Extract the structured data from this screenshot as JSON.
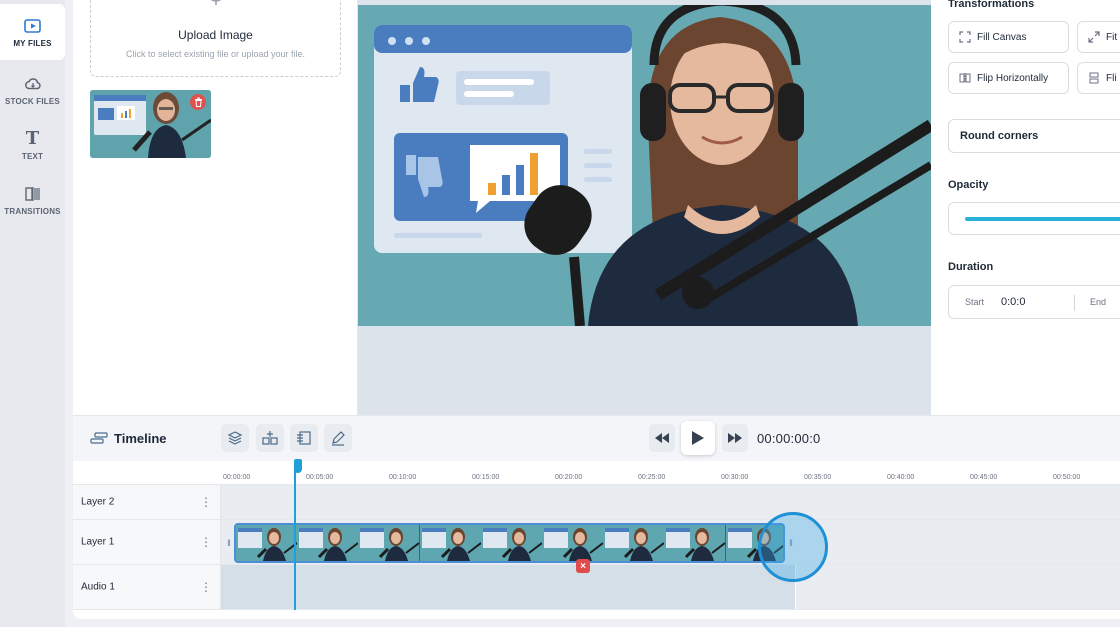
{
  "rail": {
    "items": [
      {
        "label": "MY FILES",
        "icon": "image-folder-icon"
      },
      {
        "label": "STOCK FILES",
        "icon": "cloud-icon"
      },
      {
        "label": "TEXT",
        "icon": "text-icon"
      },
      {
        "label": "TRANSITIONS",
        "icon": "transitions-icon"
      }
    ]
  },
  "files": {
    "upload_title": "Upload Image",
    "upload_subtitle": "Click to select existing file or upload your file."
  },
  "props": {
    "transformations_title": "Transformations",
    "fill_canvas": "Fill Canvas",
    "fit": "Fit",
    "flip_horizontally": "Flip Horizontally",
    "flip_vertically": "Fli",
    "round_corners": "Round corners",
    "opacity_title": "Opacity",
    "opacity_value": 1.0,
    "duration_title": "Duration",
    "start_label": "Start",
    "start_value": "0:0:0",
    "end_label": "End"
  },
  "timeline": {
    "title": "Timeline",
    "timecode": "00:00:00:0",
    "ticks": [
      "00:00:00",
      "00:05:00",
      "00:10:00",
      "00:15:00",
      "00:20:00",
      "00:25:00",
      "00:30:00",
      "00:35:00",
      "00:40:00",
      "00:45:00",
      "00:50:00"
    ],
    "tracks": [
      {
        "label": "Layer 2"
      },
      {
        "label": "Layer 1"
      },
      {
        "label": "Audio 1"
      }
    ]
  },
  "colors": {
    "accent": "#1da1d6",
    "clip_border": "#4a8ed6",
    "delete_red": "#e04b4b"
  }
}
